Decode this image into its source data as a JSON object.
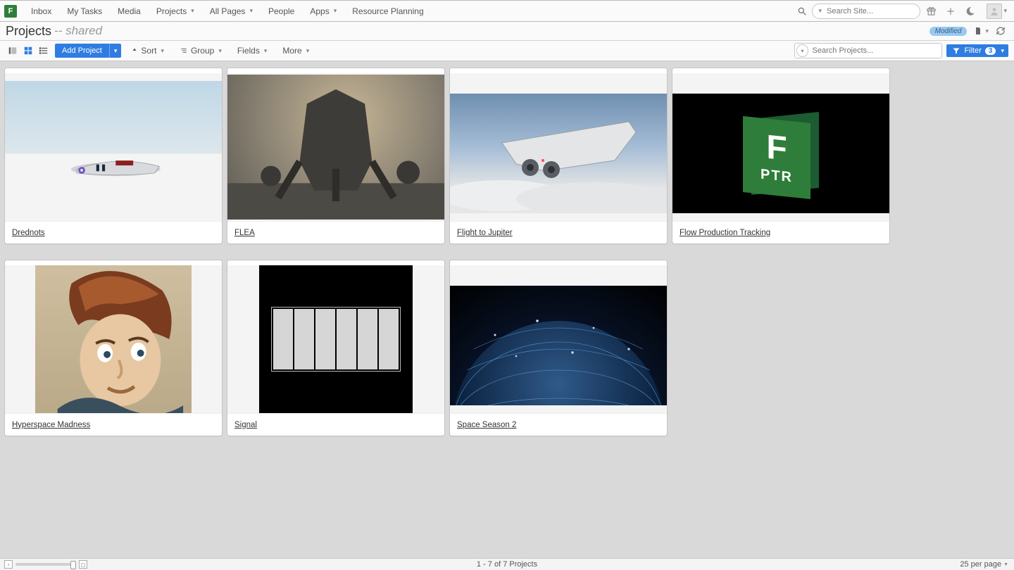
{
  "nav": {
    "items": [
      {
        "label": "Inbox",
        "dropdown": false
      },
      {
        "label": "My Tasks",
        "dropdown": false
      },
      {
        "label": "Media",
        "dropdown": false
      },
      {
        "label": "Projects",
        "dropdown": true
      },
      {
        "label": "All Pages",
        "dropdown": true
      },
      {
        "label": "People",
        "dropdown": false
      },
      {
        "label": "Apps",
        "dropdown": true
      },
      {
        "label": "Resource Planning",
        "dropdown": false
      }
    ],
    "search_placeholder": "Search Site..."
  },
  "titlebar": {
    "title": "Projects",
    "suffix": "-- shared",
    "badge": "Modified"
  },
  "toolbar": {
    "add_label": "Add Project",
    "sort_label": "Sort",
    "group_label": "Group",
    "fields_label": "Fields",
    "more_label": "More",
    "search_placeholder": "Search Projects...",
    "filter_label": "Filter",
    "filter_count": "3"
  },
  "projects": [
    {
      "title": "Drednots",
      "thumb": "drednots"
    },
    {
      "title": "FLEA",
      "thumb": "flea"
    },
    {
      "title": "Flight to Jupiter",
      "thumb": "flight"
    },
    {
      "title": "Flow Production Tracking",
      "thumb": "fpt"
    },
    {
      "title": "Hyperspace Madness",
      "thumb": "hyper"
    },
    {
      "title": "Signal",
      "thumb": "signal"
    },
    {
      "title": "Space Season 2",
      "thumb": "space"
    }
  ],
  "fpt_logo": {
    "letter": "F",
    "sub": "PTR"
  },
  "status": {
    "range": "1 - 7 of 7 Projects",
    "perpage": "25 per page"
  }
}
